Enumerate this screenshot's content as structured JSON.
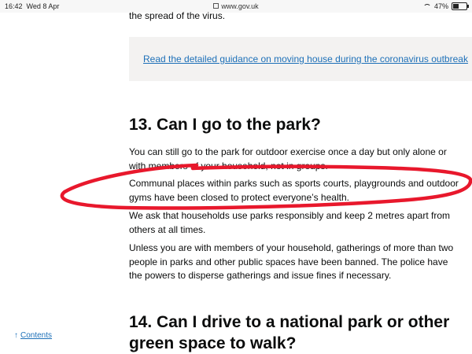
{
  "status_bar": {
    "time": "16:42",
    "date": "Wed 8 Apr",
    "url": "www.gov.uk",
    "battery": "47%"
  },
  "page": {
    "cut_text": "the spread of the virus.",
    "guidance_link": "Read the detailed guidance on moving house during the coronavirus outbreak",
    "section13": {
      "heading": "13. Can I go to the park?",
      "paragraphs": [
        "You can still go to the park for outdoor exercise once a day but only alone or with members of your household, not in groups.",
        "Communal places within parks such as sports courts, playgrounds and outdoor gyms have been closed to protect everyone’s health.",
        "We ask that households use parks responsibly and keep 2 metres apart from others at all times.",
        "Unless you are with members of your household, gatherings of more than two people in parks and other public spaces have been banned. The police have the powers to disperse gatherings and issue fines if necessary."
      ]
    },
    "section14": {
      "heading": "14. Can I drive to a national park or other green space to walk?"
    },
    "contents_link": "Contents",
    "annotation_color": "#e8182c"
  }
}
